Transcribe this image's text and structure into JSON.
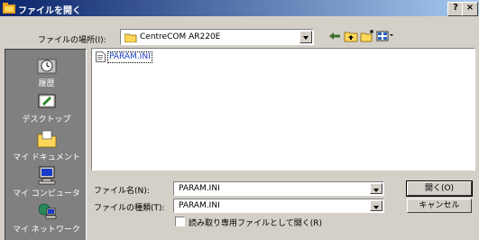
{
  "window": {
    "title": "ファイルを開く",
    "help_label": "?",
    "close_label": "×"
  },
  "location": {
    "label": "ファイルの場所(I):",
    "value": "CentreCOM AR220E"
  },
  "places": [
    {
      "label": "履歴"
    },
    {
      "label": "デスクトップ"
    },
    {
      "label": "マイ ドキュメント"
    },
    {
      "label": "マイ コンピュータ"
    },
    {
      "label": "マイ ネットワーク"
    }
  ],
  "files": [
    {
      "name": "PARAM.INI"
    }
  ],
  "filename": {
    "label": "ファイル名(N):",
    "value": "PARAM.INI"
  },
  "filetype": {
    "label": "ファイルの種類(T):",
    "value": "PARAM.INI"
  },
  "readonly": {
    "label": "読み取り専用ファイルとして開く(R)"
  },
  "buttons": {
    "open": "開く(O)",
    "cancel": "キャンセル"
  }
}
